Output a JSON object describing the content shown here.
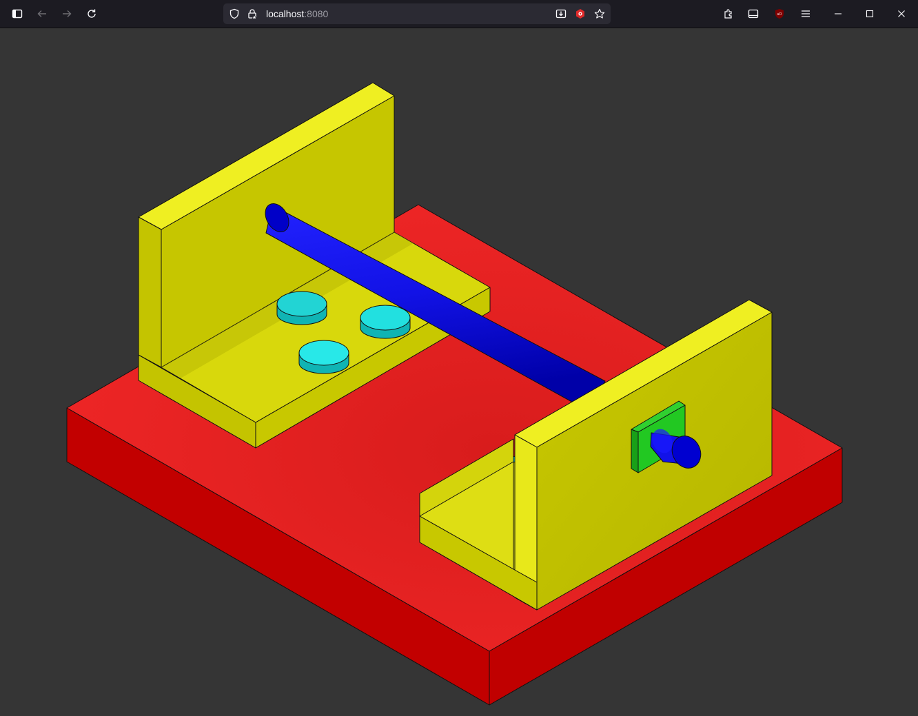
{
  "browser": {
    "url_host": "localhost",
    "url_port": ":8080",
    "icons": {
      "sidebar": "sidebar-toggle-icon",
      "back": "back-arrow-icon",
      "forward": "forward-arrow-icon",
      "reload": "reload-icon",
      "shield": "tracking-shield-icon",
      "lock": "insecure-lock-icon",
      "download": "install-app-icon",
      "extension": "extension-red-icon",
      "star": "bookmark-star-icon",
      "puzzle": "extensions-icon",
      "sync": "tab-tray-icon",
      "ublock": "ublock-icon",
      "menu": "hamburger-menu-icon",
      "minimize": "minimize-icon",
      "maximize": "maximize-icon",
      "close": "close-icon"
    }
  },
  "scene": {
    "background_color": "#353535",
    "colors": {
      "base_top": "#ec2424",
      "base_side": "#c00000",
      "bracket_top": "#eeee20",
      "bracket_face": "#c4c400",
      "shaft": "#1010e0",
      "shaft_dark": "#0000a0",
      "pads": "#20e0e0",
      "pads_dark": "#10b0b0",
      "plate": "#20c020",
      "plate_dark": "#108010"
    }
  }
}
